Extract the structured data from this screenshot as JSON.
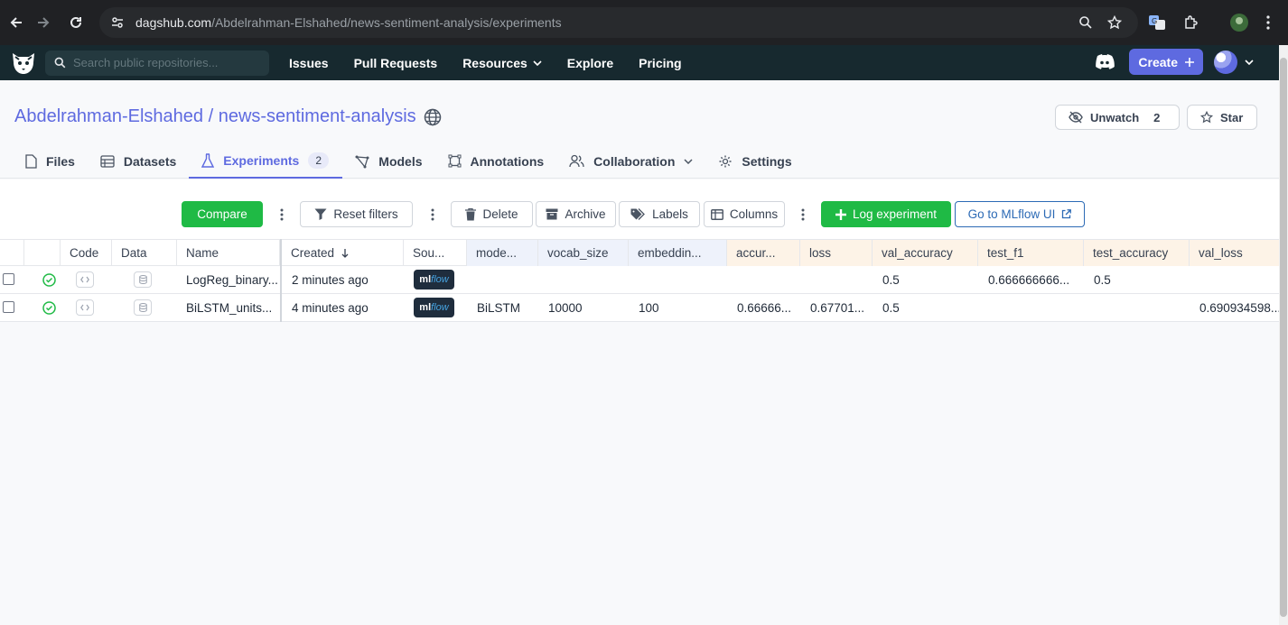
{
  "browser": {
    "url_host": "dagshub.com",
    "url_path": "/Abdelrahman-Elshahed/news-sentiment-analysis/experiments"
  },
  "topnav": {
    "search_placeholder": "Search public repositories...",
    "links": [
      "Issues",
      "Pull Requests",
      "Resources",
      "Explore",
      "Pricing"
    ],
    "create_label": "Create"
  },
  "repo": {
    "owner": "Abdelrahman-Elshahed",
    "separator": " / ",
    "name": "news-sentiment-analysis",
    "unwatch_label": "Unwatch",
    "watch_count": "2",
    "star_label": "Star"
  },
  "tabs": [
    {
      "label": "Files"
    },
    {
      "label": "Datasets"
    },
    {
      "label": "Experiments",
      "badge": "2"
    },
    {
      "label": "Models"
    },
    {
      "label": "Annotations"
    },
    {
      "label": "Collaboration"
    },
    {
      "label": "Settings"
    }
  ],
  "toolbar": {
    "compare": "Compare",
    "reset_filters": "Reset filters",
    "delete": "Delete",
    "archive": "Archive",
    "labels": "Labels",
    "columns": "Columns",
    "log_experiment": "Log experiment",
    "go_mlflow": "Go to MLflow UI"
  },
  "table": {
    "headers": [
      "Code",
      "Data",
      "Name",
      "Created",
      "Sou...",
      "mode...",
      "vocab_size",
      "embeddin...",
      "accur...",
      "loss",
      "val_accuracy",
      "test_f1",
      "test_accuracy",
      "val_loss"
    ],
    "rows": [
      {
        "name": "LogReg_binary...",
        "created": "2 minutes ago",
        "source": "mlflow",
        "model": "",
        "vocab_size": "",
        "embedding": "",
        "accuracy": "",
        "loss": "",
        "val_accuracy": "0.5",
        "test_f1": "0.666666666...",
        "test_accuracy": "0.5",
        "val_loss": ""
      },
      {
        "name": "BiLSTM_units...",
        "created": "4 minutes ago",
        "source": "mlflow",
        "model": "BiLSTM",
        "vocab_size": "10000",
        "embedding": "100",
        "accuracy": "0.66666...",
        "loss": "0.67701...",
        "val_accuracy": "0.5",
        "test_f1": "",
        "test_accuracy": "",
        "val_loss": "0.690934598..."
      }
    ]
  },
  "colors": {
    "brand": "#5e6ae0",
    "green": "#1fba45",
    "header_bg": "#17292f"
  }
}
